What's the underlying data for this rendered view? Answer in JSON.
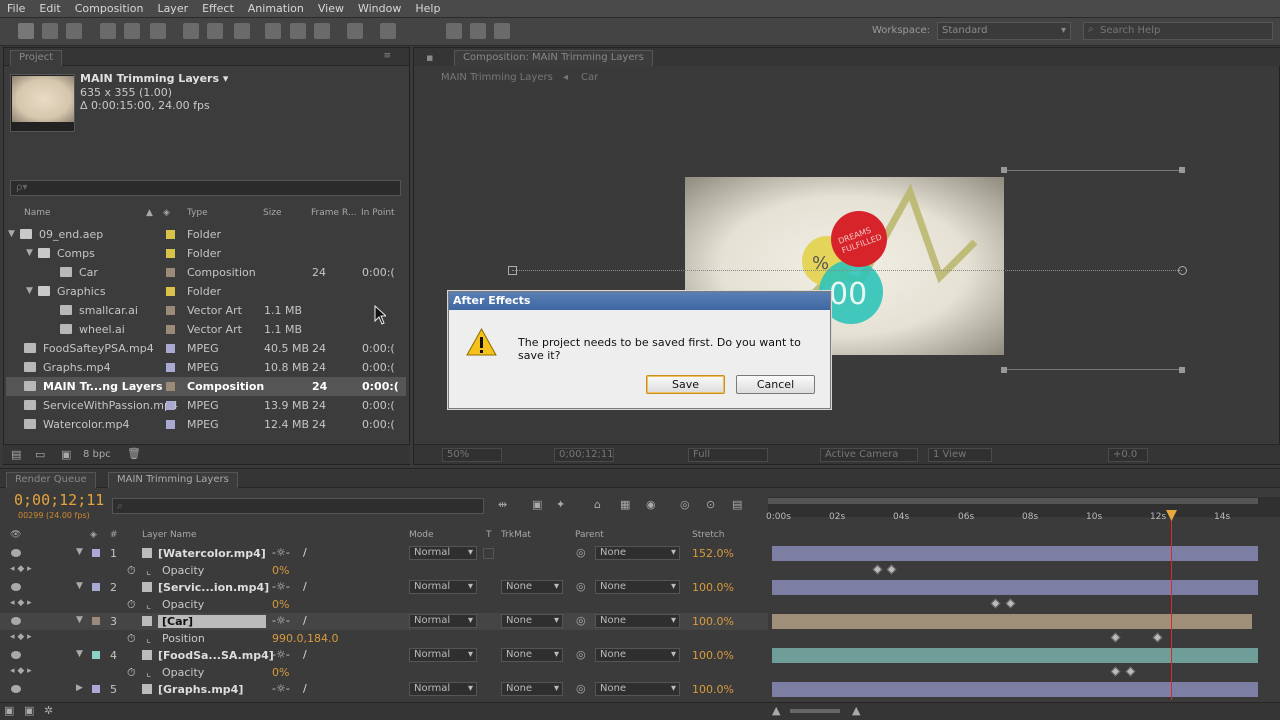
{
  "menu": [
    "File",
    "Edit",
    "Composition",
    "Layer",
    "Effect",
    "Animation",
    "View",
    "Window",
    "Help"
  ],
  "toolbar": {
    "workspace_label": "Workspace:",
    "workspace_value": "Standard",
    "search_help_placeholder": "Search Help"
  },
  "project": {
    "tab": "Project",
    "comp_name": "MAIN Trimming Layers ▾",
    "comp_size": "635 x 355 (1.00)",
    "comp_duration": "Δ 0:00:15:00, 24.00 fps",
    "search_placeholder": "ρ▾",
    "columns": [
      "Name",
      "Type",
      "Size",
      "Frame R...",
      "In Point"
    ],
    "items": [
      {
        "name": "09_end.aep",
        "type": "Folder",
        "size": "",
        "fr": "",
        "ip": "",
        "color": "#d8c24a"
      },
      {
        "name": "Comps",
        "type": "Folder",
        "size": "",
        "fr": "",
        "ip": "",
        "color": "#d8c24a"
      },
      {
        "name": "Car",
        "type": "Composition",
        "size": "",
        "fr": "24",
        "ip": "0:00:(",
        "color": "#9a8b78"
      },
      {
        "name": "Graphics",
        "type": "Folder",
        "size": "",
        "fr": "",
        "ip": "",
        "color": "#d8c24a"
      },
      {
        "name": "smallcar.ai",
        "type": "Vector Art",
        "size": "1.1 MB",
        "fr": "",
        "ip": "",
        "color": "#9a8b78"
      },
      {
        "name": "wheel.ai",
        "type": "Vector Art",
        "size": "1.1 MB",
        "fr": "",
        "ip": "",
        "color": "#9a8b78"
      },
      {
        "name": "FoodSafteyPSA.mp4",
        "type": "MPEG",
        "size": "40.5 MB",
        "fr": "24",
        "ip": "0:00:(",
        "color": "#a9a9d2"
      },
      {
        "name": "Graphs.mp4",
        "type": "MPEG",
        "size": "10.8 MB",
        "fr": "24",
        "ip": "0:00:(",
        "color": "#a9a9d2"
      },
      {
        "name": "MAIN Tr...ng Layers",
        "type": "Composition",
        "size": "",
        "fr": "24",
        "ip": "0:00:(",
        "color": "#9a8b78"
      },
      {
        "name": "ServiceWithPassion.mp4",
        "type": "MPEG",
        "size": "13.9 MB",
        "fr": "24",
        "ip": "0:00:(",
        "color": "#a9a9d2"
      },
      {
        "name": "Watercolor.mp4",
        "type": "MPEG",
        "size": "12.4 MB",
        "fr": "24",
        "ip": "0:00:(",
        "color": "#a9a9d2"
      }
    ],
    "bpc": "8 bpc"
  },
  "composition": {
    "tab": "Composition: MAIN Trimming Layers",
    "crumbs": [
      "MAIN Trimming Layers",
      "Car"
    ],
    "footer": {
      "zoom": "50%",
      "time": "0;00;12;11",
      "res": "Full",
      "camera": "Active Camera",
      "view": "1 View",
      "exposure": "+0.0"
    }
  },
  "dialog": {
    "title": "After Effects",
    "message": "The project needs to be saved first. Do you want to save it?",
    "save": "Save",
    "cancel": "Cancel"
  },
  "timeline": {
    "tabs": [
      "Render Queue",
      "MAIN Trimming Layers"
    ],
    "timecode": "0;00;12;11",
    "frames": "00299 (24.00 fps)",
    "columns": {
      "layer_name": "Layer Name",
      "mode": "Mode",
      "t": "T",
      "trkmat": "TrkMat",
      "parent": "Parent",
      "stretch": "Stretch"
    },
    "ruler": [
      "0:00s",
      "02s",
      "04s",
      "06s",
      "08s",
      "10s",
      "12s",
      "14s"
    ],
    "layers": [
      {
        "num": "1",
        "name": "[Watercolor.mp4]",
        "mode": "Normal",
        "trk": "",
        "parent": "None",
        "stretch": "152.0%",
        "prop": "Opacity",
        "pval": "0%",
        "color": "#a9a9d2"
      },
      {
        "num": "2",
        "name": "[Servic...ion.mp4]",
        "mode": "Normal",
        "trk": "None",
        "parent": "None",
        "stretch": "100.0%",
        "prop": "Opacity",
        "pval": "0%",
        "color": "#a9a9d2"
      },
      {
        "num": "3",
        "name": "[Car]",
        "mode": "Normal",
        "trk": "None",
        "parent": "None",
        "stretch": "100.0%",
        "prop": "Position",
        "pval": "990.0,184.0",
        "color": "#9a8b78"
      },
      {
        "num": "4",
        "name": "[FoodSa...SA.mp4]",
        "mode": "Normal",
        "trk": "None",
        "parent": "None",
        "stretch": "100.0%",
        "prop": "Opacity",
        "pval": "0%",
        "color": "#8fcfc6"
      },
      {
        "num": "5",
        "name": "[Graphs.mp4]",
        "mode": "Normal",
        "trk": "None",
        "parent": "None",
        "stretch": "100.0%",
        "prop": "",
        "pval": "",
        "color": "#a9a9d2"
      }
    ]
  }
}
